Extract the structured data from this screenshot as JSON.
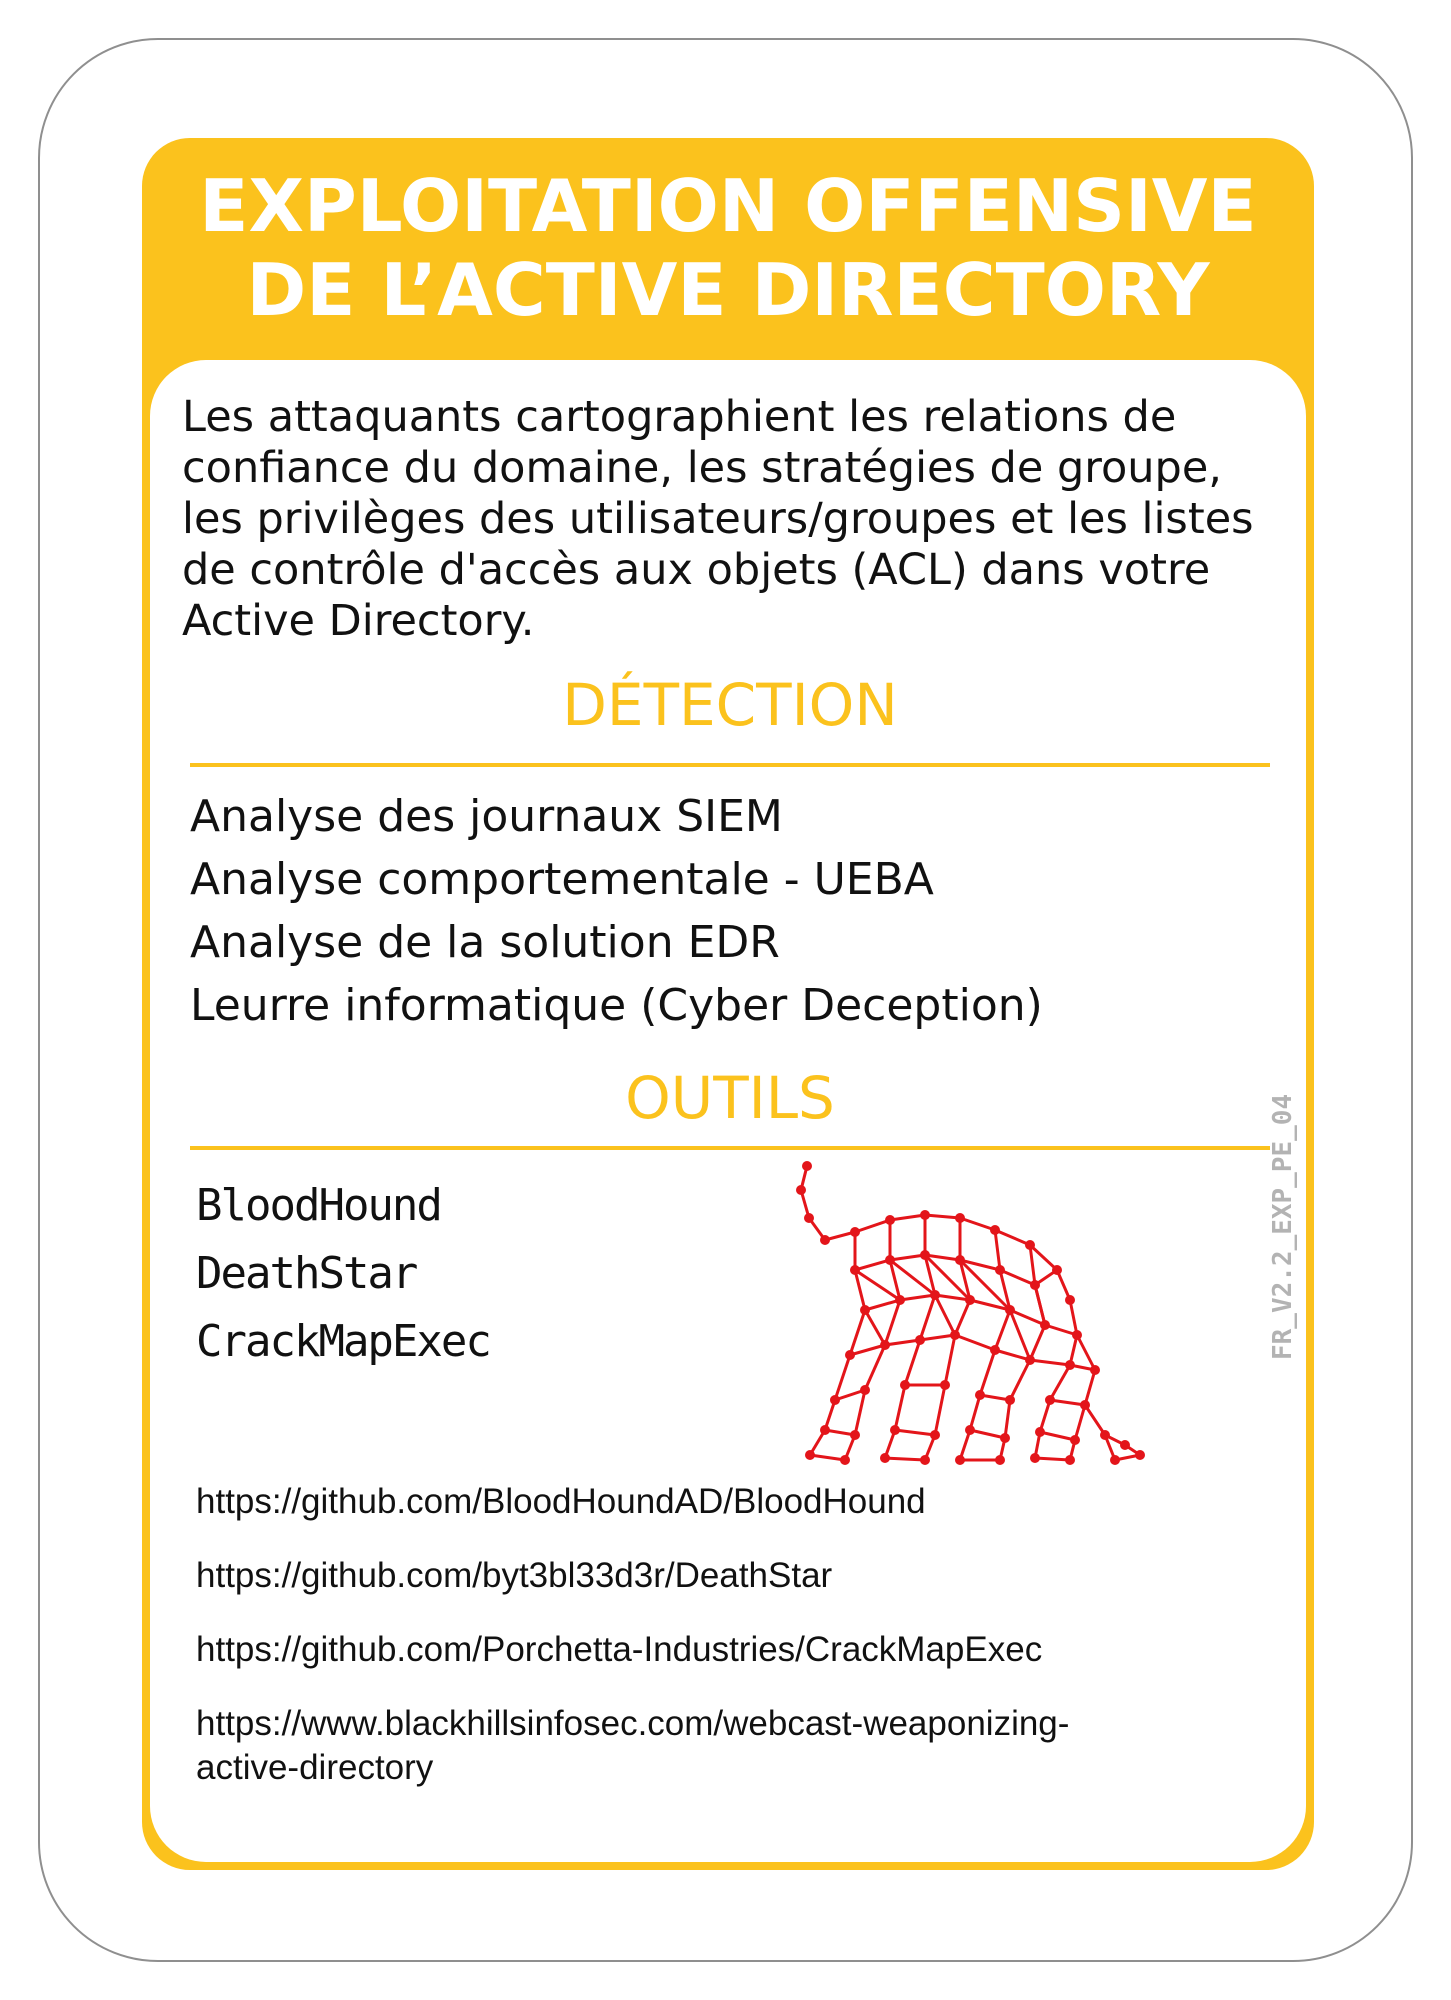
{
  "card": {
    "title_line1": "EXPLOITATION OFFENSIVE",
    "title_line2": "DE L’ACTIVE DIRECTORY",
    "intro": "Les attaquants cartographient les relations de confiance du domaine, les stratégies de groupe, les privilèges des utilisateurs/groupes et les listes de contrôle d'accès aux objets (ACL) dans votre Active Directory.",
    "version_code": "FR_V2.2_EXP_PE_04",
    "accent_color": "#fbc21d",
    "illustration_icon": "network-dog-icon",
    "illustration_color": "#e3151a"
  },
  "detection": {
    "heading": "DÉTECTION",
    "items": [
      "Analyse des journaux SIEM",
      "Analyse comportementale - UEBA",
      "Analyse de la solution EDR",
      "Leurre informatique (Cyber Deception)"
    ]
  },
  "tools": {
    "heading": "OUTILS",
    "items": [
      "BloodHound",
      "DeathStar",
      "CrackMapExec"
    ],
    "links": [
      "https://github.com/BloodHoundAD/BloodHound",
      "https://github.com/byt3bl33d3r/DeathStar",
      "https://github.com/Porchetta-Industries/CrackMapExec",
      "https://www.blackhillsinfosec.com/webcast-weaponizing-active-directory"
    ]
  }
}
